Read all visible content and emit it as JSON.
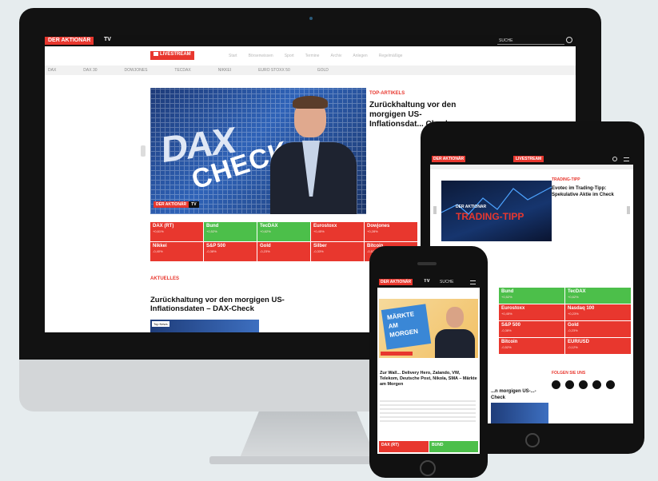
{
  "brand": {
    "name": "DER AKTIONÄR",
    "tv": "TV"
  },
  "header": {
    "search": "SUCHE",
    "livestream": "LIVESTREAM"
  },
  "nav": [
    "Start",
    "Börsenwissen",
    "Sport",
    "Termine",
    "Archiv",
    "Anlegen",
    "Regelmäßige"
  ],
  "ticker": [
    "DAX",
    "DAX 30",
    "DOWJONES",
    "TECDAX",
    "NIKKEI",
    "EURO STOXX 50",
    "GOLD"
  ],
  "hero": {
    "logo": "DAX",
    "word": "CHECK",
    "section": "TOP-ARTIKELS",
    "headline": "Zurückhaltung vor den morgigen US-Inflationsdaten – DAX-Check",
    "headline_short": "Zurückhaltung vor den morgigen US-Inflationsdat... Check"
  },
  "markets": [
    {
      "name": "DAX (RT)",
      "change": "+0,61%"
    },
    {
      "name": "Bund",
      "change": "+0,52%"
    },
    {
      "name": "TecDAX",
      "change": "+0,62%"
    },
    {
      "name": "Eurostoxx",
      "change": "+0,45%"
    },
    {
      "name": "Dowjones",
      "change": "+0,28%"
    },
    {
      "name": "Nikkei",
      "change": "-0,40%"
    },
    {
      "name": "S&P 500",
      "change": "-0,38%"
    },
    {
      "name": "Gold",
      "change": "-0,23%"
    },
    {
      "name": "Silber",
      "change": "-0,33%"
    },
    {
      "name": "Bitcoin",
      "change": "-0,52%"
    }
  ],
  "aktuelles": {
    "label": "AKTUELLES",
    "headline": "Zurückhaltung vor den morgigen US-Inflationsdaten – DAX-Check",
    "badge": "Top News"
  },
  "tablet": {
    "section": "TRADING-TIPP",
    "hero_label": "TRADING-TIPP",
    "hero_brand": "DER AKTIONÄR",
    "headline": "Evotec im Trading-Tipp: Spekulative Aktie im Check",
    "markets": [
      {
        "name": "Bund",
        "change": "+0,52%"
      },
      {
        "name": "TecDAX",
        "change": "+0,62%"
      },
      {
        "name": "Eurostoxx",
        "change": "+0,45%"
      },
      {
        "name": "Nasdaq 100",
        "change": "+0,23%"
      },
      {
        "name": "S&P 500",
        "change": "-0,38%"
      },
      {
        "name": "Gold",
        "change": "-0,23%"
      },
      {
        "name": "Bitcoin",
        "change": "-0,52%"
      },
      {
        "name": "EUR/USD",
        "change": "-0,12%"
      }
    ],
    "social_label": "FOLGEN SIE UNS",
    "subhead": "...n morgigen US-...-Check"
  },
  "phone": {
    "brand": "DER AKTIONÄR",
    "tv": "TV",
    "search": "SUCHE",
    "hero_text": [
      "MÄRKTE",
      "AM",
      "MORGEN"
    ],
    "headline": "Zur Wall... Delivery Hero, Zalando, VW, Telekom, Deutsche Post, Nikola, SMA – Märkte am Morgen",
    "bottom_left": "DAX (RT)",
    "bottom_right": "BUND"
  }
}
